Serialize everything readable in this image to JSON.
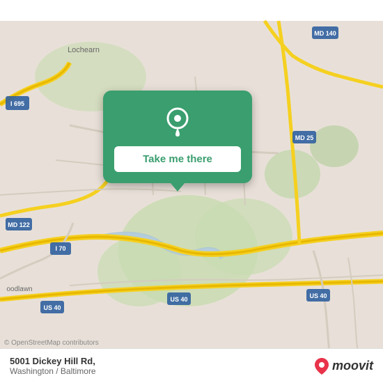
{
  "map": {
    "attribution": "© OpenStreetMap contributors",
    "background_color": "#e8e0d8"
  },
  "popup": {
    "button_label": "Take me there"
  },
  "bottom_bar": {
    "address": "5001 Dickey Hill Rd,",
    "city": "Washington / Baltimore",
    "logo_text": "moovit"
  },
  "icons": {
    "location_pin": "location-pin-icon",
    "moovit_pin": "moovit-pin-icon"
  }
}
